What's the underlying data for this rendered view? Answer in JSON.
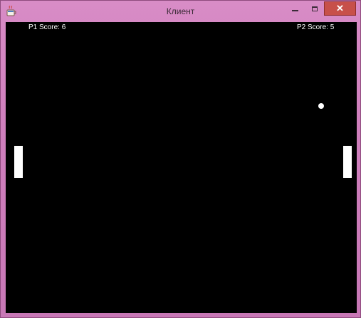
{
  "window": {
    "title": "Клиент",
    "close_glyph": "✕",
    "icons": {
      "app": "java-app-icon",
      "minimize": "minimize-icon",
      "maximize": "maximize-icon",
      "close": "close-icon"
    }
  },
  "game": {
    "p1_score": "P1 Score: 6",
    "p2_score": "P2 Score: 5",
    "colors": {
      "background": "#000000",
      "paddles": "#ffffff",
      "ball": "#ffffff"
    }
  }
}
